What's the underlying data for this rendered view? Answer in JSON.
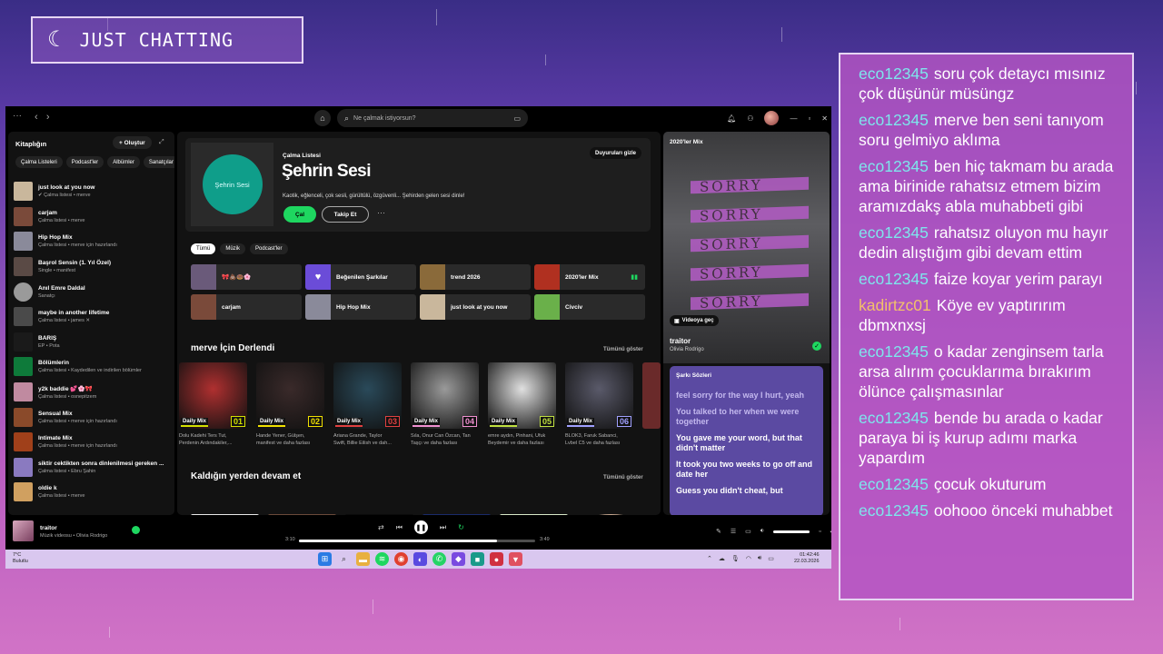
{
  "stream": {
    "badge_icon": "moon-icon",
    "badge_text": "JUST CHATTING"
  },
  "chat": [
    {
      "user": "eco12345",
      "text": "soru çok detaycı mısınız çok düşünür müsüngz"
    },
    {
      "user": "eco12345",
      "text": "merve ben seni tanıyom soru gelmiyo aklıma"
    },
    {
      "user": "eco12345",
      "text": "ben hiç takmam bu arada ama birinide rahatsız etmem bizim aramızdakş abla muhabbeti gibi"
    },
    {
      "user": "eco12345",
      "text": "rahatsız oluyon mu hayır dedin alıştığım gibi devam ettim"
    },
    {
      "user": "eco12345",
      "text": "faize koyar yerim parayı"
    },
    {
      "user": "kadirtzc01",
      "text": "Köye ev yaptırırım dbmxnxsj"
    },
    {
      "user": "eco12345",
      "text": "o kadar zenginsem tarla arsa alırım çocuklarıma bırakırım ölünce çalışmasınlar"
    },
    {
      "user": "eco12345",
      "text": "bende bu arada o kadar paraya bi iş kurup adımı marka yapardım"
    },
    {
      "user": "eco12345",
      "text": "çocuk okuturum"
    },
    {
      "user": "eco12345",
      "text": "oohooo önceki muhabbet"
    }
  ],
  "spotify": {
    "search_placeholder": "Ne çalmak istiyorsun?",
    "library": {
      "title": "Kitaplığın",
      "create": "+ Oluştur",
      "chips": [
        "Çalma Listeleri",
        "Podcast'ler",
        "Albümler",
        "Sanatçılar"
      ],
      "items": [
        {
          "title": "just look at you now",
          "sub": "✔ Çalma listesi • merve",
          "color": "#c9b79c"
        },
        {
          "title": "carjam",
          "sub": "Çalma listesi • merve",
          "color": "#7a4a3a"
        },
        {
          "title": "Hip Hop Mix",
          "sub": "Çalma listesi • merve için hazırlandı",
          "color": "#8a8a9a"
        },
        {
          "title": "Başrol Sensin (1. Yıl Özel)",
          "sub": "Single • manifest",
          "color": "#5a4a45"
        },
        {
          "title": "Anıl Emre Daldal",
          "sub": "Sanatçı",
          "color": "#9a9a9a",
          "round": true
        },
        {
          "title": "maybe in another lifetime",
          "sub": "Çalma listesi • james ✕",
          "color": "#4a4a4a"
        },
        {
          "title": "BARIŞ",
          "sub": "EP • Pota",
          "color": "#1a1a1a"
        },
        {
          "title": "Bölümlerin",
          "sub": "Çalma listesi • Kaydedilen ve indirilen bölümler",
          "color": "#0e7a3a"
        },
        {
          "title": "y2k baddie 💕🌸🎀",
          "sub": "Çalma listesi • osnepitzem",
          "color": "#c08aa0"
        },
        {
          "title": "Sensual Mix",
          "sub": "Çalma listesi • merve için hazırlandı",
          "color": "#8a4a2a"
        },
        {
          "title": "Intimate Mix",
          "sub": "Çalma listesi • merve için hazırlandı",
          "color": "#a0401a"
        },
        {
          "title": "siktir cektikten sonra dinlenilmesi gereken ...",
          "sub": "Çalma listesi • Ebru Şahin",
          "color": "#8a7ac0"
        },
        {
          "title": "oldie k",
          "sub": "Çalma listesi • merve",
          "color": "#d0a060"
        }
      ]
    },
    "hero": {
      "type": "Çalma Listesi",
      "title": "Şehrin Sesi",
      "cover_text": "Şehrin Sesi",
      "desc": "Kaotik, eğlenceli, çok sesli, gürültülü, özgüvenli... Şehirden gelen sesi dinle!",
      "play": "Çal",
      "follow": "Takip Et",
      "hide": "Duyuruları gizle"
    },
    "filters": [
      "Tümü",
      "Müzik",
      "Podcast'ler"
    ],
    "quick": [
      {
        "label": "🎀💩🍩🌸",
        "color": "#6a5a7a"
      },
      {
        "label": "Beğenilen Şarkılar",
        "color": "#6b4cd8",
        "icon": "heart-icon"
      },
      {
        "label": "trend 2026",
        "color": "#8a6a3a"
      },
      {
        "label": "2020'ler Mix",
        "color": "#b03020",
        "eq": true
      },
      {
        "label": "carjam",
        "color": "#7a4a3a"
      },
      {
        "label": "Hip Hop Mix",
        "color": "#8a8a9a"
      },
      {
        "label": "just look at you now",
        "color": "#c9b79c"
      },
      {
        "label": "Civciv",
        "color": "#6ab04a"
      }
    ],
    "made_for": {
      "title": "merve İçin Derlendi",
      "show_all": "Tümünü göster",
      "mixes": [
        {
          "badge": "Daily Mix",
          "num": "01",
          "sub1": "Dolu Kadehi Ters Tut,",
          "sub2": "Perdenin Ardındakiler,...",
          "color": "#b03030",
          "accent": "#d4e000"
        },
        {
          "badge": "Daily Mix",
          "num": "02",
          "sub1": "Hande Yener, Gülşen,",
          "sub2": "manifest ve daha fazlası",
          "color": "#3a2a2a",
          "accent": "#f0e000"
        },
        {
          "badge": "Daily Mix",
          "num": "03",
          "sub1": "Ariana Grande, Taylor",
          "sub2": "Swift, Billie Eilish ve dah...",
          "color": "#2a4a5a",
          "accent": "#e04040"
        },
        {
          "badge": "Daily Mix",
          "num": "04",
          "sub1": "Sıla, Onur Can Özcan, Tan",
          "sub2": "Taşçı ve daha fazlası",
          "color": "#9a9a9a",
          "accent": "#f090d0"
        },
        {
          "badge": "Daily Mix",
          "num": "05",
          "sub1": "emre aydın, Pinhani, Ufuk",
          "sub2": "Beydemir ve daha fazlası",
          "color": "#e0e0e0",
          "accent": "#c0e040"
        },
        {
          "badge": "Daily Mix",
          "num": "06",
          "sub1": "BLOK3, Faruk Sabanci,",
          "sub2": "Lvbel C5 ve daha fazlası",
          "color": "#5a5a6a",
          "accent": "#a0a0ff"
        }
      ]
    },
    "continue": {
      "title": "Kaldığın yerden devam et",
      "show_all": "Tümünü göster"
    },
    "now_playing": {
      "category": "2020'ler Mix",
      "title": "traitor",
      "artist": "Olivia Rodrigo",
      "video_btn": "Videoya geç",
      "lyrics_title": "Şarkı Sözleri",
      "lyrics": [
        "feel sorry for the way I hurt, yeah",
        "You talked to her when we were together",
        "You gave me your word, but that didn't matter",
        "It took you two weeks to go off and date her",
        "Guess you didn't cheat, but"
      ]
    },
    "player": {
      "title": "traitor",
      "artist": "Müzik videosu • Olivia Rodrigo",
      "elapsed": "3:10",
      "duration": "3:49",
      "progress": 0.84
    },
    "taskbar": {
      "temp": "7°C",
      "weather": "Bulutlu",
      "time": "01:42:46",
      "date": "22.03.2026"
    }
  }
}
